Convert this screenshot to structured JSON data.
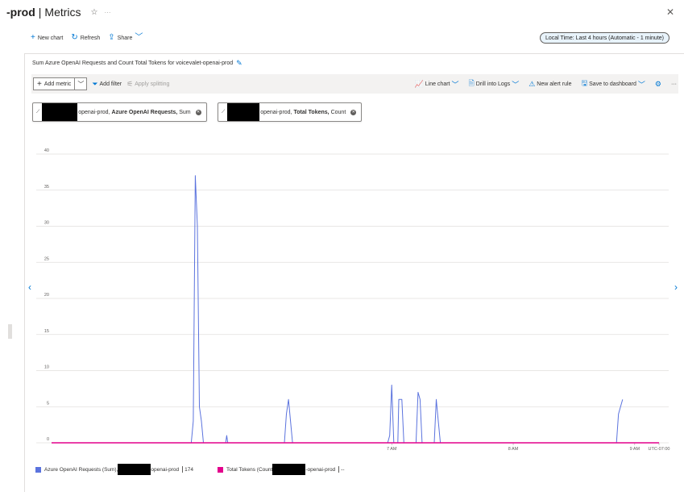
{
  "header": {
    "title_bold": "-prod",
    "title_sep": "|",
    "title_rest": "Metrics",
    "close": "✕"
  },
  "commandbar": {
    "new_chart": "New chart",
    "refresh": "Refresh",
    "share": "Share"
  },
  "time_range": "Local Time: Last 4 hours (Automatic - 1 minute)",
  "chart": {
    "title": "Sum Azure OpenAI Requests and Count Total Tokens for voicevalet-openai-prod",
    "toolbar": {
      "add_metric": "Add metric",
      "add_filter": "Add filter",
      "apply_splitting": "Apply splitting",
      "line_chart": "Line chart",
      "drill_logs": "Drill into Logs",
      "new_alert": "New alert rule",
      "save_dashboard": "Save to dashboard"
    },
    "pills": [
      {
        "pre": "openai-prod,",
        "metric": "Azure OpenAI Requests,",
        "agg": "Sum"
      },
      {
        "pre": "openai-prod,",
        "metric": "Total Tokens,",
        "agg": "Count"
      }
    ],
    "legend": [
      {
        "label_pre": "Azure OpenAI Requests (Sum),",
        "label_post": "openai-prod",
        "value": "174",
        "color": "#5b73de"
      },
      {
        "label_pre": "Total Tokens (Count",
        "label_post": "-openai-prod",
        "value": "--",
        "color": "#e3008c"
      }
    ]
  },
  "chart_data": {
    "type": "line",
    "ylim": [
      0,
      40
    ],
    "y_ticks": [
      "0",
      "5",
      "10",
      "15",
      "20",
      "25",
      "30",
      "35",
      "40"
    ],
    "x_tick_labels": [
      "7 AM",
      "8 AM",
      "9 AM",
      "UTC-07:00"
    ],
    "x_tick_minutes": [
      168,
      228,
      288,
      300
    ],
    "x_range_minutes": [
      0,
      300
    ],
    "series": [
      {
        "name": "Azure OpenAI Requests (Sum)",
        "color": "#5b73de",
        "points": [
          [
            0,
            0
          ],
          [
            69,
            0
          ],
          [
            70,
            3
          ],
          [
            71,
            37
          ],
          [
            72,
            30
          ],
          [
            73,
            5
          ],
          [
            74,
            3
          ],
          [
            75,
            0
          ],
          [
            86,
            0
          ],
          [
            86.5,
            1
          ],
          [
            87,
            0
          ],
          [
            115,
            0
          ],
          [
            116,
            4
          ],
          [
            117,
            6
          ],
          [
            118,
            3
          ],
          [
            119,
            0
          ],
          [
            166,
            0
          ],
          [
            167,
            1
          ],
          [
            168,
            8
          ],
          [
            169,
            0
          ],
          [
            171,
            0
          ],
          [
            171.5,
            6
          ],
          [
            173,
            6
          ],
          [
            174,
            0
          ],
          [
            180,
            0
          ],
          [
            181,
            7
          ],
          [
            182,
            6
          ],
          [
            183,
            0
          ],
          [
            189,
            0
          ],
          [
            190,
            6
          ],
          [
            191,
            3
          ],
          [
            192,
            0
          ],
          [
            279,
            0
          ],
          [
            280,
            4
          ],
          [
            282,
            6
          ]
        ]
      },
      {
        "name": "Total Tokens (Count)",
        "color": "#e3008c",
        "points": [
          [
            0,
            0
          ],
          [
            300,
            0
          ]
        ]
      }
    ]
  }
}
